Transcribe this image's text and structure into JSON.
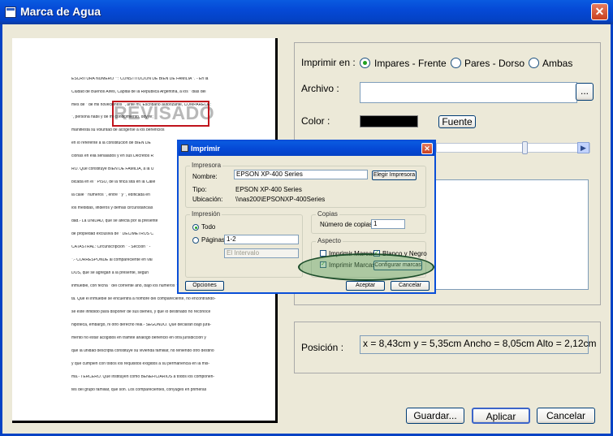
{
  "window": {
    "title": "Marca de Agua",
    "close": "✕"
  },
  "preview": {
    "watermark": "REVISADO",
    "lines": [
      "ESCRITURA NUMERO \"\": CONSTITUCION DE BIEN DE FAMILIA \". - En la",
      "Ciudad de Buenos Aires, Capital de la Republica Argentina, a los \" dias del",
      "mes de \" de mil novecientos \", ante mi, Escribano autorizante, COMPARECE:",
      "\", persona habil y de mi conocimiento, doy fe;",
      "manifiesta su voluntad de acogerse a los beneficios",
      "en lo referente a la constitucion de BIEN DE",
      "cionas en ella senalados y en sus Decretos R",
      "RO. Que constituye BIEN DE FAMILIA, a la U",
      "bicada en el \" PISO, de la finca sita en la Calle",
      "la calle \" numeros \", entre \" y \", edificada en",
      "los medidas, linderos y demas circunstancias",
      "dad.- La UNIDAD, que se afecta por la presente",
      "de propiedad exclusiva de \" DECIMETROS C",
      "CATASTRAL: Circunscripcion \" - Seccion \" -",
      "\".- CORRESPONDE al compareciente en val",
      "DOS, que se agregan a la presente, segun",
      "inmueble, con fecha \" del corriente ano, bajo los numeros \", resulta y se acredi-",
      "ta. Que el inmueble se encuentra a nombre del compareciente, no encontrando-",
      "se este inhibido para disponer de sus bienes, y que lo destinado no reconoce",
      "hipoteca, embargo, ni otro derecho real.- SEGUNDO. Que declaran bajo jura-",
      "mento no estar acogidos en tramite analogo beneficio en otra jurisdiccion y",
      "que la unidad descripta constituye su vivienda familiar, no teniendo otro destino",
      "y que cumplen con todos los requisitos exigidos a su permanencia en la mis-",
      "ma.- TERCERO. Que instituyen como BENEFICIARIOS a todos los componen-",
      "tes del grupo familiar, que son. Los comparecientes, conyuges en primeras"
    ]
  },
  "print_on": {
    "label": "Imprimir en :",
    "options": [
      "Impares - Frente",
      "Pares - Dorso",
      "Ambas"
    ],
    "selected": "Impares - Frente"
  },
  "file": {
    "label": "Archivo :",
    "value": "",
    "browse": "..."
  },
  "color": {
    "label": "Color :",
    "value": "#000000",
    "font_button": "Fuente"
  },
  "position": {
    "label": "Posición :",
    "value": "x = 8,43cm y = 5,35cm Ancho = 8,05cm Alto = 2,12cm"
  },
  "buttons": {
    "save": "Guardar...",
    "apply": "Aplicar",
    "cancel": "Cancelar"
  },
  "print_dialog": {
    "title": "Imprimir",
    "printer_group": "Impresora",
    "name_label": "Nombre:",
    "name_value": "EPSON XP-400 Series",
    "choose_printer": "Elegir Impresora",
    "type_label": "Tipo:",
    "type_value": "EPSON XP-400 Series",
    "location_label": "Ubicación:",
    "location_value": "\\\\nas200\\EPSONXP-400Series",
    "print_group": "Impresión",
    "all_label": "Todo",
    "pages_label": "Páginas:",
    "pages_value": "1-2",
    "range_value": "El Intervalo",
    "copies_group": "Copias",
    "copies_label": "Número de copias:",
    "copies_value": "1",
    "aspect_group": "Aspecto",
    "print_marks_1": "Imprimir Marcas",
    "black_white": "Blanco y Negro",
    "print_marks_2": "Imprimir Marcas",
    "config_marks": "Configurar marcas",
    "options": "Opciones",
    "accept": "Aceptar",
    "cancel": "Cancelar"
  }
}
